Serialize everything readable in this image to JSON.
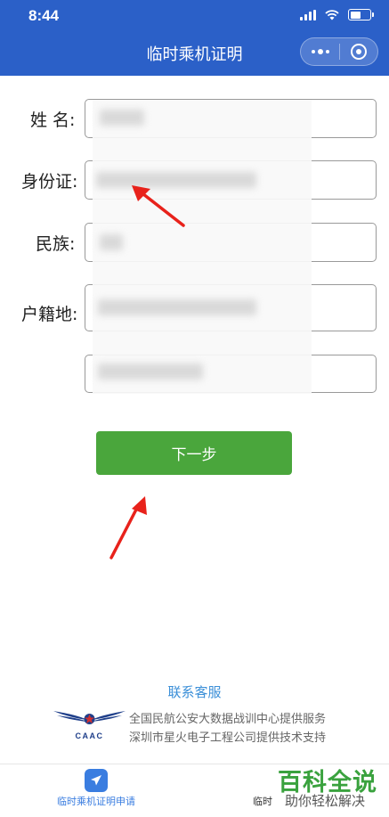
{
  "status_bar": {
    "time": "8:44"
  },
  "header": {
    "title": "临时乘机证明"
  },
  "form": {
    "name_label": "姓 名:",
    "id_label": "身份证:",
    "ethnicity_label": "民族:",
    "household_label": "户籍地:"
  },
  "next_button": {
    "label": "下一步"
  },
  "footer": {
    "contact_label": "联系客服",
    "logo_text": "CAAC",
    "line1": "全国民航公安大数据战训中心提供服务",
    "line2": "深圳市星火电子工程公司提供技术支持"
  },
  "tabbar": {
    "tab1_label": "临时乘机证明申请",
    "tab2_label": "临时"
  },
  "watermark": {
    "title": "百科全说",
    "subtitle": "助你轻松解决"
  },
  "colors": {
    "header": "#2b60c8",
    "button": "#4aa63c",
    "link": "#3b8fd8",
    "watermark": "#3aa23e",
    "arrow": "#e8221b"
  }
}
